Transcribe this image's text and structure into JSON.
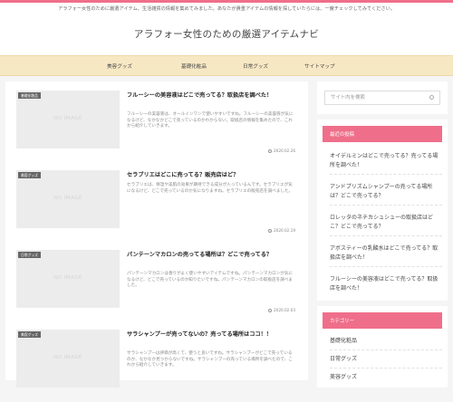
{
  "header": {
    "tagline": "アラフォー女性のために厳選アイテム、生活雑貨の情報を集めてみました。あなたが貴重アイテムの情報を探していたらには、一度チェックしてみてください。",
    "site_title": "アラフォー女性のための厳選アイテムナビ"
  },
  "nav": {
    "items": [
      {
        "label": "美容グッズ"
      },
      {
        "label": "基礎化粧品"
      },
      {
        "label": "日常グッズ"
      },
      {
        "label": "サイトマップ"
      }
    ]
  },
  "posts": [
    {
      "category": "基礎化粧品",
      "thumb": "NO IMAGE",
      "title": "フルーシーの美容液はどこで売ってる？取扱店を調べた！",
      "excerpt": "フルーシーの美容液は、オールインワンで使いやすいですね。フルーシーの美容液が気になるけど、なかなかどこで売っているのかわからない。取扱店の情報を集めたので、これから紹介していきます。",
      "date": "2020.02.26"
    },
    {
      "category": "美容グッズ",
      "thumb": "NO IMAGE",
      "title": "セラブリエはどこに売ってる？販売店はど？",
      "excerpt": "セラブリエは、保湿や美肌の効果が期待できる成分が入っているんです。セラブリエが気になるけど、どこで売っているのか気になりますね。セラブリエの販売店を調べました。",
      "date": "2020.02.19"
    },
    {
      "category": "日常グッズ",
      "thumb": "NO IMAGE",
      "title": "パンテーンマカロンの売ってる場所は？どこで売ってる？",
      "excerpt": "パンテーンマカロンは香りがよく使いやすいアイテムですね。パンテーンマカロンが気になるけど、どこで売っているのか知りたいですね。パンテーンマカロンの取扱店を調べました。",
      "date": "2020.02.03"
    },
    {
      "category": "美容グッズ",
      "thumb": "NO IMAGE",
      "title": "サラシャンプーが売ってないの？売ってる場所はココ！！",
      "excerpt": "サラシャンプーは評価が高くて、使うと良いですね。サラシャンプーがどこで売っているのか、なかなか見つからないですね。サラシャンプーの売っている場所を調べたので、これから紹介していきます。",
      "date": ""
    }
  ],
  "sidebar": {
    "search_placeholder": "サイト内を検索",
    "recent": {
      "title": "最近の投稿",
      "items": [
        {
          "label": "オイデルミンはどこで売ってる？売ってる場所を調べた！"
        },
        {
          "label": "アンドプリズムシャンプーの売ってる場所は？どこで売ってる？"
        },
        {
          "label": "ロレッタのネチカシュシューの取扱店はどこ？どこで売ってる？"
        },
        {
          "label": "アボスティーの乳酸水はどこで売ってる？取扱店を調べた！"
        },
        {
          "label": "フルーシーの美容液はどこで売ってる？取扱店を調べた！"
        }
      ]
    },
    "categories": {
      "title": "カテゴリー",
      "items": [
        {
          "label": "基礎化粧品"
        },
        {
          "label": "日常グッズ"
        },
        {
          "label": "美容グッズ"
        }
      ]
    }
  },
  "colors": {
    "accent": "#ef6f8a",
    "nav_bg": "#f7e8c4"
  }
}
